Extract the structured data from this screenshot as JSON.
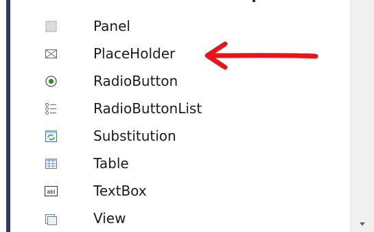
{
  "toolbox": {
    "items": [
      {
        "label": "Panel",
        "icon": "panel-icon"
      },
      {
        "label": "PlaceHolder",
        "icon": "placeholder-icon"
      },
      {
        "label": "RadioButton",
        "icon": "radio-button-icon"
      },
      {
        "label": "RadioButtonList",
        "icon": "radio-button-list-icon"
      },
      {
        "label": "Substitution",
        "icon": "substitution-icon"
      },
      {
        "label": "Table",
        "icon": "table-icon"
      },
      {
        "label": "TextBox",
        "icon": "textbox-icon"
      },
      {
        "label": "View",
        "icon": "view-icon"
      }
    ],
    "textbox_icon_text": "abl"
  },
  "annotation": {
    "arrow_color": "#e8141c",
    "points_to": "PlaceHolder"
  },
  "colors": {
    "rail": "#2d3d5f",
    "text": "#1b1b1b",
    "radio": "#2e8b2e"
  }
}
